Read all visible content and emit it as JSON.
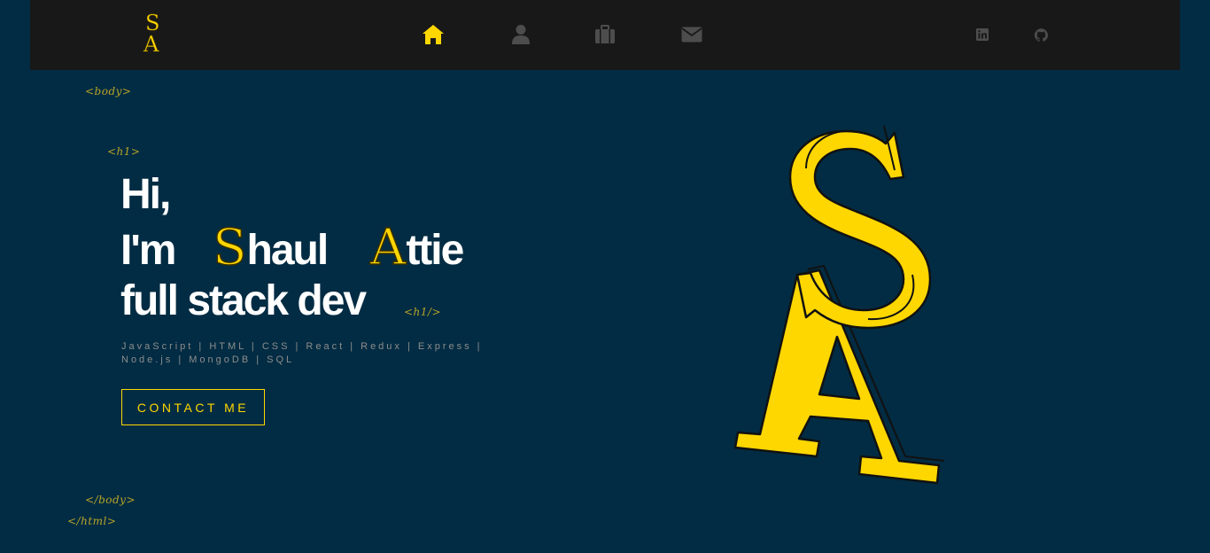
{
  "nav": {
    "logo_icon": "sa-monogram-logo",
    "items": [
      {
        "name": "home",
        "icon": "home-icon",
        "color": "#ffd700"
      },
      {
        "name": "about",
        "icon": "user-icon",
        "color": "#4d4d4e"
      },
      {
        "name": "portfolio",
        "icon": "briefcase-icon",
        "color": "#4d4d4e"
      },
      {
        "name": "contact",
        "icon": "envelope-icon",
        "color": "#4d4d4e"
      }
    ],
    "social": [
      {
        "name": "linkedin",
        "icon": "linkedin-icon"
      },
      {
        "name": "github",
        "icon": "github-icon"
      }
    ]
  },
  "tags": {
    "body_open": "<body>",
    "h1_open": "<h1>",
    "h1_close": "<h1/>",
    "body_close": "</body>",
    "html_close": "</html>"
  },
  "hero": {
    "line1": "Hi,",
    "line2_prefix": "I'm",
    "first_initial": "S",
    "first_rest": "haul",
    "last_initial": "A",
    "last_rest": "ttie",
    "line3": "full stack dev",
    "skills": "JavaScript | HTML | CSS | React | Redux | Express | Node.js | MongoDB | SQL",
    "cta_label": "CONTACT ME"
  },
  "colors": {
    "background": "#022c43",
    "navbar": "#181818",
    "accent": "#ffd700",
    "tag": "#b8a427",
    "muted_icon": "#4d4d4e"
  }
}
